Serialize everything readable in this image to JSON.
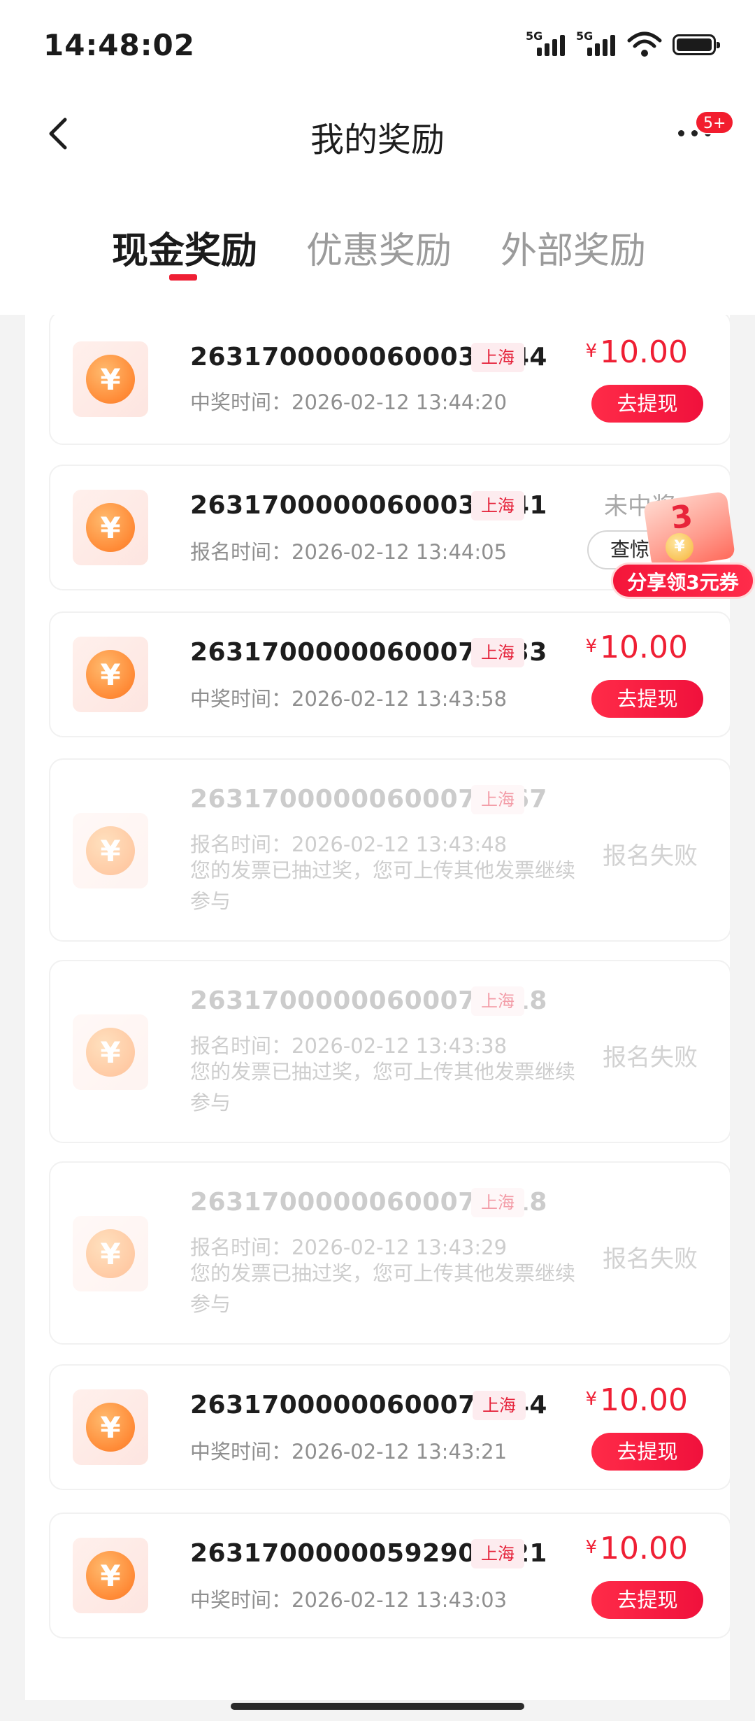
{
  "status_bar": {
    "time": "14:48:02",
    "net1": "5G",
    "net2": "5G"
  },
  "nav": {
    "title": "我的奖励",
    "badge": "5+"
  },
  "tabs": [
    {
      "label": "现金奖励",
      "active": true
    },
    {
      "label": "优惠奖励",
      "active": false
    },
    {
      "label": "外部奖励",
      "active": false
    }
  ],
  "records": [
    {
      "invoice": "26317000000600031744",
      "city": "上海",
      "time_label": "中奖时间：",
      "time": "2026-02-12 13:44:20",
      "status": "won",
      "currency": "¥",
      "amount": "10.00",
      "action": "去提现"
    },
    {
      "invoice": "26317000000600030541",
      "city": "上海",
      "time_label": "报名时间：",
      "time": "2026-02-12 13:44:05",
      "status": "not_won",
      "status_text": "未中奖",
      "action": "查惊喜"
    },
    {
      "invoice": "26317000000600072333",
      "city": "上海",
      "time_label": "中奖时间：",
      "time": "2026-02-12 13:43:58",
      "status": "won",
      "currency": "¥",
      "amount": "10.00",
      "action": "去提现"
    },
    {
      "invoice": "26317000000600072467",
      "city": "上海",
      "time_label": "报名时间：",
      "time": "2026-02-12 13:43:48",
      "status": "failed",
      "status_text": "报名失败",
      "note": "您的发票已抽过奖，您可上传其他发票继续参与"
    },
    {
      "invoice": "26317000000600072518",
      "city": "上海",
      "time_label": "报名时间：",
      "time": "2026-02-12 13:43:38",
      "status": "failed",
      "status_text": "报名失败",
      "note": "您的发票已抽过奖，您可上传其他发票继续参与"
    },
    {
      "invoice": "26317000000600072518",
      "city": "上海",
      "time_label": "报名时间：",
      "time": "2026-02-12 13:43:29",
      "status": "failed",
      "status_text": "报名失败",
      "note": "您的发票已抽过奖，您可上传其他发票继续参与"
    },
    {
      "invoice": "26317000000600072344",
      "city": "上海",
      "time_label": "中奖时间：",
      "time": "2026-02-12 13:43:21",
      "status": "won",
      "currency": "¥",
      "amount": "10.00",
      "action": "去提现"
    },
    {
      "invoice": "26317000000592906321",
      "city": "上海",
      "time_label": "中奖时间：",
      "time": "2026-02-12 13:43:03",
      "status": "won",
      "currency": "¥",
      "amount": "10.00",
      "action": "去提现"
    }
  ],
  "float_promo": {
    "number": "3",
    "label": "分享领3元券"
  },
  "colors": {
    "accent": "#ef1f34",
    "badge": "#f21d2e",
    "coin": "#ff8a36"
  },
  "icons": {
    "back": "chevron-left-icon",
    "more": "more-dots-icon",
    "coin": "yuan-coin-icon"
  }
}
